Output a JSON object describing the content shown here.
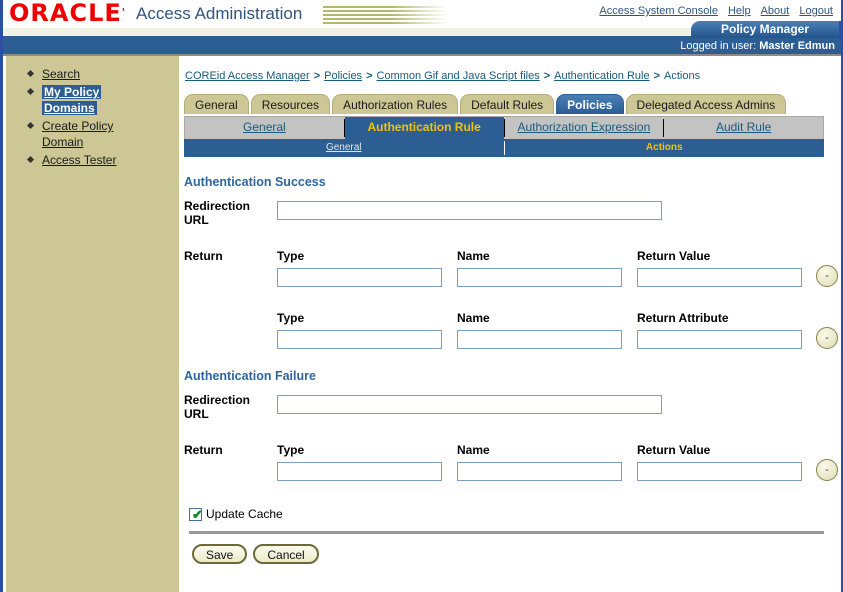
{
  "header": {
    "logo_text": "ORACLE",
    "app_title": "Access Administration",
    "links": [
      {
        "label": "Access System Console"
      },
      {
        "label": "Help"
      },
      {
        "label": "About"
      },
      {
        "label": "Logout"
      }
    ],
    "product_tab": "Policy Manager",
    "logged_in_label": "Logged in user:",
    "logged_in_user": "Master Edmun"
  },
  "sidebar": {
    "items": [
      {
        "label": "Search",
        "selected": false
      },
      {
        "label": "My Policy",
        "label2": "Domains",
        "selected": true
      },
      {
        "label": "Create Policy",
        "label2": "Domain",
        "selected": false
      },
      {
        "label": "Access Tester",
        "selected": false
      }
    ]
  },
  "breadcrumb": {
    "items": [
      {
        "label": "COREid Access Manager",
        "link": true
      },
      {
        "label": "Policies",
        "link": true
      },
      {
        "label": "Common Gif and Java Script files",
        "link": true
      },
      {
        "label": "Authentication Rule",
        "link": true
      },
      {
        "label": "Actions",
        "link": false
      }
    ],
    "separator": ">"
  },
  "tabs_level1": [
    {
      "label": "General",
      "active": false
    },
    {
      "label": "Resources",
      "active": false
    },
    {
      "label": "Authorization Rules",
      "active": false
    },
    {
      "label": "Default Rules",
      "active": false
    },
    {
      "label": "Policies",
      "active": true
    },
    {
      "label": "Delegated Access Admins",
      "active": false
    }
  ],
  "tabs_level2": [
    {
      "label": "General",
      "active": false
    },
    {
      "label": "Authentication Rule",
      "active": true
    },
    {
      "label": "Authorization Expression",
      "active": false
    },
    {
      "label": "Audit Rule",
      "active": false
    }
  ],
  "tabs_level3": [
    {
      "label": "General",
      "active": false
    },
    {
      "label": "Actions",
      "active": true
    }
  ],
  "main": {
    "success": {
      "title": "Authentication Success",
      "redirection_label": "Redirection URL",
      "redirection_value": "",
      "return_label": "Return",
      "row1": {
        "type_label": "Type",
        "type_value": "",
        "name_label": "Name",
        "name_value": "",
        "value_label": "Return Value",
        "value_value": "",
        "remove_icon": "minus-icon"
      },
      "row2": {
        "type_label": "Type",
        "type_value": "",
        "name_label": "Name",
        "name_value": "",
        "value_label": "Return Attribute",
        "value_value": "",
        "remove_icon": "minus-icon"
      }
    },
    "failure": {
      "title": "Authentication Failure",
      "redirection_label": "Redirection URL",
      "redirection_value": "",
      "return_label": "Return",
      "row1": {
        "type_label": "Type",
        "type_value": "",
        "name_label": "Name",
        "name_value": "",
        "value_label": "Return Value",
        "value_value": "",
        "remove_icon": "minus-icon"
      }
    },
    "update_cache_label": "Update Cache",
    "update_cache_checked": true,
    "check_glyph": "✔",
    "save_label": "Save",
    "cancel_label": "Cancel"
  },
  "colors": {
    "brand_red": "#ee0000",
    "header_blue": "#2d5e93",
    "khaki": "#ccc795",
    "accent_gold": "#f2c300",
    "link_blue": "#1a5a7a"
  }
}
